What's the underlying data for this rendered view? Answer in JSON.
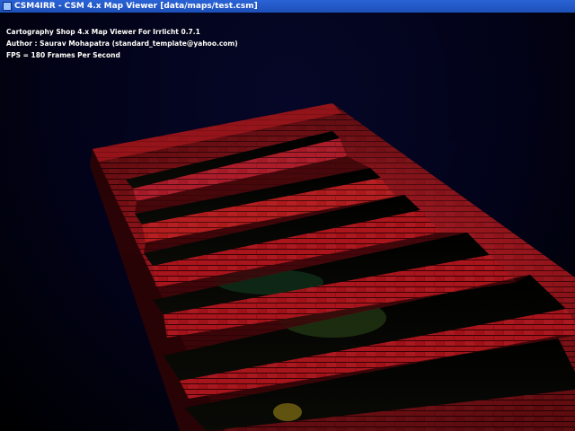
{
  "window": {
    "title": "CSM4IRR - CSM 4.x Map Viewer [data/maps/test.csm]",
    "icon": "app-icon"
  },
  "hud": {
    "line1": "Cartography Shop 4.x Map Viewer For Irrlicht 0.7.1",
    "line2": "Author : Saurav Mohapatra (standard_template@yahoo.com)",
    "line3": "FPS = 180 Frames Per Second"
  },
  "colors": {
    "titlebar": "#1d4fb7",
    "brick": "#a5121a",
    "brick_dark": "#4a0408",
    "background": "#02031a"
  }
}
